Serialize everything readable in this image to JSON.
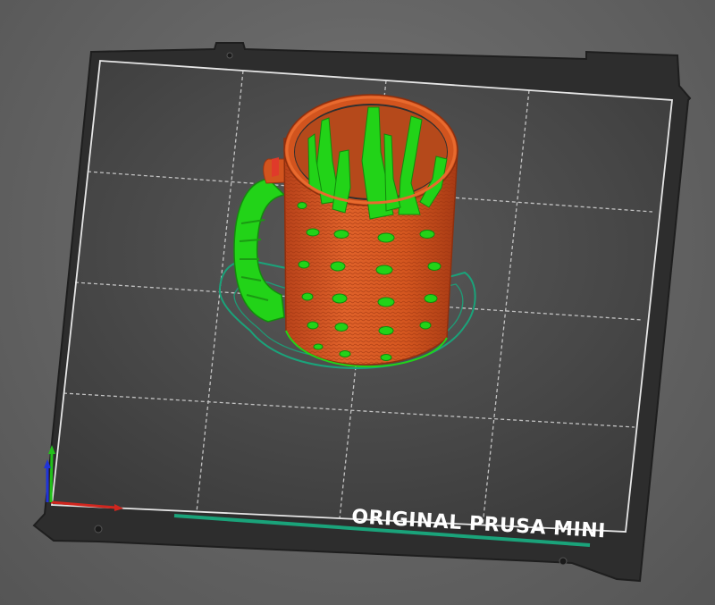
{
  "printer": {
    "bed_label": "ORIGINAL PRUSA MINI"
  },
  "colors": {
    "background": "#666666",
    "bed_plate": "#2e2e2e",
    "bed_surface": "#4a4a4a",
    "grid_lines": "#d8d8d8",
    "perimeter": "#d2541e",
    "infill_support": "#22d318",
    "skirt": "#1aa37a",
    "axis_x": "#d0261e",
    "axis_y": "#22c01a",
    "axis_z": "#2033d8"
  },
  "icons": {
    "axes": "xyz-axes-icon"
  }
}
